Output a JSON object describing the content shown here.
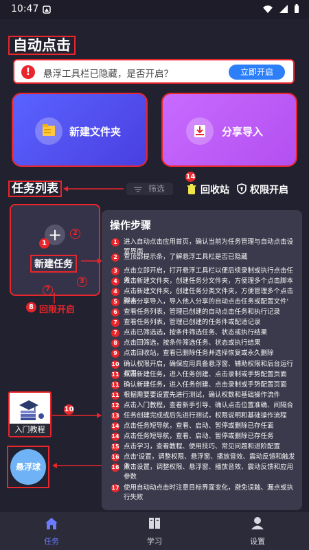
{
  "status_bar": {
    "time": "10:47"
  },
  "header": {
    "title": "自动点击"
  },
  "banner": {
    "icon": "!",
    "text": "悬浮工具栏已隐藏，是否开启？",
    "button": "立即开启"
  },
  "cards": {
    "new_folder": "新建文件夹",
    "share_import": "分享导入"
  },
  "task_list": {
    "title": "任务列表",
    "filter": "筛选",
    "recycle": "回收站",
    "permission": "权限开启",
    "new_task": "新建任务",
    "new_task_plus": "+",
    "back_home": "回限开启"
  },
  "annotations": [
    "1",
    "2",
    "3",
    "7",
    "8",
    "10",
    "14"
  ],
  "steps": {
    "title": "操作步骤",
    "items": [
      {
        "n": "1",
        "text": "进入自动点击应用首页，确认当前为任务管理与自动点击设置界面"
      },
      {
        "n": "2",
        "text": "查顶部提示条，了解悬浮工具栏是否已隐藏"
      },
      {
        "n": "3",
        "text": "点击立即开启，打开悬浮工具栏以便后续录制或执行点击任务"
      },
      {
        "n": "4",
        "text": "点击新建文件夹，创建任务分文件夹，方便理多个点击脚本"
      },
      {
        "n": "4",
        "text": "点击新建文件夹，创建任务分类文件夹，方便管理多个点击脚本"
      },
      {
        "n": "5",
        "text": "点击分享导入，导入他人分享的自动点击任务或配置文件'"
      },
      {
        "n": "6",
        "text": "查看任务列表，管理已创建的自动点击任务和执行记录"
      },
      {
        "n": "7",
        "text": "查看任务列表，管理已创建的任务件或配适记录"
      },
      {
        "n": "7",
        "text": "点击已筛选选，按条件筛选任务、状态或执行结果"
      },
      {
        "n": "8",
        "text": "点击回筛选，按条件筛选任务、状态或执行结果"
      },
      {
        "n": "9",
        "text": "点击回收站，查看已删除任务并选择恢复或永久删除"
      },
      {
        "n": "10",
        "text": "确认权限开启，确保应用具备悬浮窗、辅助权限和后台运行权限"
      },
      {
        "n": "11",
        "text": "点击新建任务，进入任务创建、点击录制或手势配置页面"
      },
      {
        "n": "11",
        "text": "确认新建任务，进入任务创建、点击录制或手势配置页面"
      },
      {
        "n": "11",
        "text": "根据需要要设置先进行测试，确认权数和基础操作流件"
      },
      {
        "n": "12",
        "text": "点击入门教程，查看新手引导、确认点击位置准确、间隔合"
      },
      {
        "n": "13",
        "text": "任务创建完成或后先进行测试，权限说明和基础操作流程"
      },
      {
        "n": "14",
        "text": "点击任务短导航，查看、启动、暂停或删除已存任面"
      },
      {
        "n": "14",
        "text": "点击任务短导航，查看、启动、暂停或删除已存任务"
      },
      {
        "n": "15",
        "text": "点击学习，查看教程、使用技巧、常见问题和进阶配置"
      },
      {
        "n": "16",
        "text": "点击'设置，调整权限、悬浮窗、播放音效、震动反馈和触发条"
      },
      {
        "n": "16",
        "text": "点击设置，调整权限、悬浮窗、播放音效、震动反馈和应用参数"
      },
      {
        "n": "17",
        "text": "使用自动动点击时注意目标界面变化，避免误触、漏点或执行失败"
      }
    ]
  },
  "tutorial": {
    "label": "入门教程"
  },
  "float_ball": {
    "label": "悬浮球"
  },
  "nav": {
    "task": "任务",
    "learn": "学习",
    "settings": "设置"
  },
  "colors": {
    "accent": "#e8262b",
    "primary": "#2d7ff9",
    "nav_active": "#6b7bff",
    "background": "#22212f"
  }
}
